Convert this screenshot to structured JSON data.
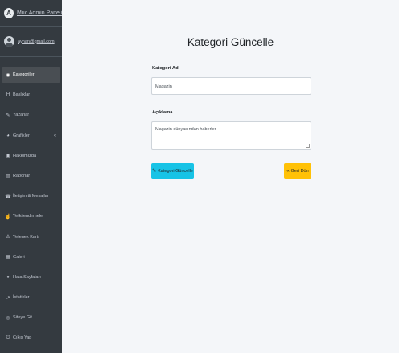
{
  "brand": {
    "title": "Muc Admin Paneli",
    "logo_letter": "A"
  },
  "user": {
    "email": "ayhan@gmail.com"
  },
  "sidebar": {
    "items": [
      {
        "label": "Kategoriler",
        "icon": "tags-icon",
        "glyph": "◉"
      },
      {
        "label": "Başlıklar",
        "icon": "heading-icon",
        "glyph": "H"
      },
      {
        "label": "Yazarlar",
        "icon": "pen-icon",
        "glyph": "✎"
      },
      {
        "label": "Grafikler",
        "icon": "chart-pie-icon",
        "glyph": "◕",
        "arrow": "‹"
      },
      {
        "label": "Hakkımızda",
        "icon": "info-box-icon",
        "glyph": "▣"
      },
      {
        "label": "Raporlar",
        "icon": "report-icon",
        "glyph": "▤"
      },
      {
        "label": "İletişim & Mesajlar",
        "icon": "phone-icon",
        "glyph": "☎"
      },
      {
        "label": "Yetkilendirmeler",
        "icon": "thumbs-up-icon",
        "glyph": "☝"
      },
      {
        "label": "Yetenek Kartı",
        "icon": "user-card-icon",
        "glyph": "♙"
      },
      {
        "label": "Galeri",
        "icon": "gallery-icon",
        "glyph": "▦"
      },
      {
        "label": "Hata Sayfaları",
        "icon": "error-icon",
        "glyph": "●"
      },
      {
        "label": "İstatikler",
        "icon": "stats-icon",
        "glyph": "↗"
      },
      {
        "label": "Siteye Git",
        "icon": "globe-icon",
        "glyph": "◎"
      },
      {
        "label": "Çıkış Yap",
        "icon": "logout-icon",
        "glyph": "⏻"
      }
    ]
  },
  "form": {
    "title": "Kategori Güncelle",
    "name_label": "Kategori Adı",
    "name_value": "Magazin",
    "desc_label": "Açıklama",
    "desc_value": "Magazin dünyasından haberler",
    "submit_label": "Kategori Güncelle",
    "back_label": "Geri Dön"
  },
  "colors": {
    "sidebar_bg": "#343a40",
    "page_bg": "#f4f6f9",
    "info_button": "#17c3e6",
    "warning_button": "#ffc107"
  }
}
